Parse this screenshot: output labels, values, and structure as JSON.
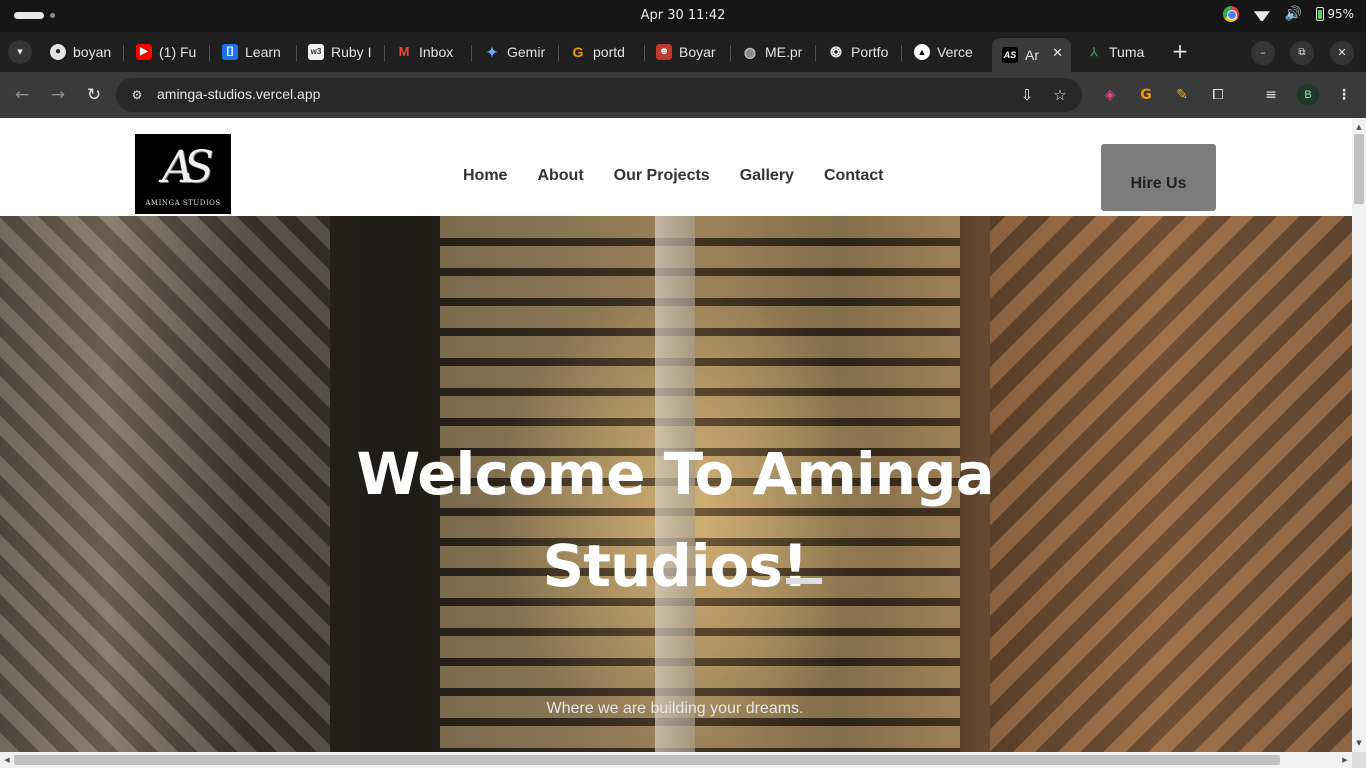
{
  "os": {
    "clock": "Apr 30  11:42",
    "battery": "95%",
    "icons": [
      "chrome-icon",
      "wifi-icon",
      "volume-icon",
      "battery-icon"
    ]
  },
  "tabs": [
    {
      "label": "boyan",
      "favicon": "github-icon"
    },
    {
      "label": "(1) Fu",
      "favicon": "youtube-icon"
    },
    {
      "label": "Learn",
      "favicon": "bracket-icon"
    },
    {
      "label": "Ruby I",
      "favicon": "w3schools-icon"
    },
    {
      "label": "Inbox",
      "favicon": "gmail-icon"
    },
    {
      "label": "Gemir",
      "favicon": "gemini-icon"
    },
    {
      "label": "portd",
      "favicon": "orange-g-icon"
    },
    {
      "label": "Boyar",
      "favicon": "avatar-icon"
    },
    {
      "label": "ME.pr",
      "favicon": "globe-icon"
    },
    {
      "label": "Portfo",
      "favicon": "openai-icon"
    },
    {
      "label": "Verce",
      "favicon": "vercel-icon"
    },
    {
      "label": "Ar",
      "favicon": "aminga-icon",
      "active": true
    },
    {
      "label": "Tuma",
      "favicon": "leaf-icon"
    }
  ],
  "toolbar": {
    "url": "aminga-studios.vercel.app",
    "profile_initial": "B"
  },
  "site": {
    "logo_sub": "AMINGA STUDIOS",
    "logo_mark": "AS",
    "nav": [
      "Home",
      "About",
      "Our Projects",
      "Gallery",
      "Contact"
    ],
    "hire_label": "Hire Us",
    "hero_title": "Welcome To Aminga Studios!",
    "hero_sub": "Where we are building your dreams."
  }
}
